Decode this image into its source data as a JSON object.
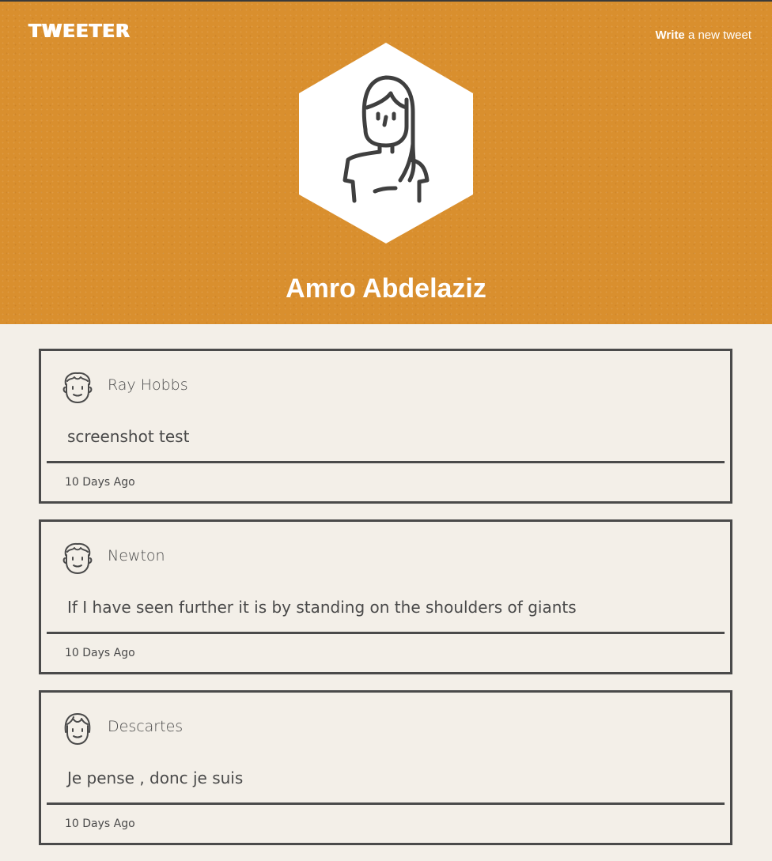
{
  "app": {
    "logo": "TWEETER",
    "write_link": {
      "strong": "Write",
      "rest": " a new tweet"
    },
    "colors": {
      "header": "#d98f2e",
      "background": "#f3efe8",
      "ink": "#4a4a4a"
    }
  },
  "profile": {
    "name": "Amro Abdelaziz",
    "avatar_icon": "woman-avatar-icon"
  },
  "tweets": [
    {
      "author": "Ray Hobbs",
      "avatar_icon": "man-avatar-icon",
      "text": "screenshot test",
      "time": "10 Days Ago"
    },
    {
      "author": "Newton",
      "avatar_icon": "man-avatar-icon",
      "text": "If I have seen further it is by standing on the shoulders of giants",
      "time": "10 Days Ago"
    },
    {
      "author": "Descartes",
      "avatar_icon": "woman-avatar-icon",
      "text": "Je pense , donc je suis",
      "time": "10 Days Ago"
    }
  ]
}
